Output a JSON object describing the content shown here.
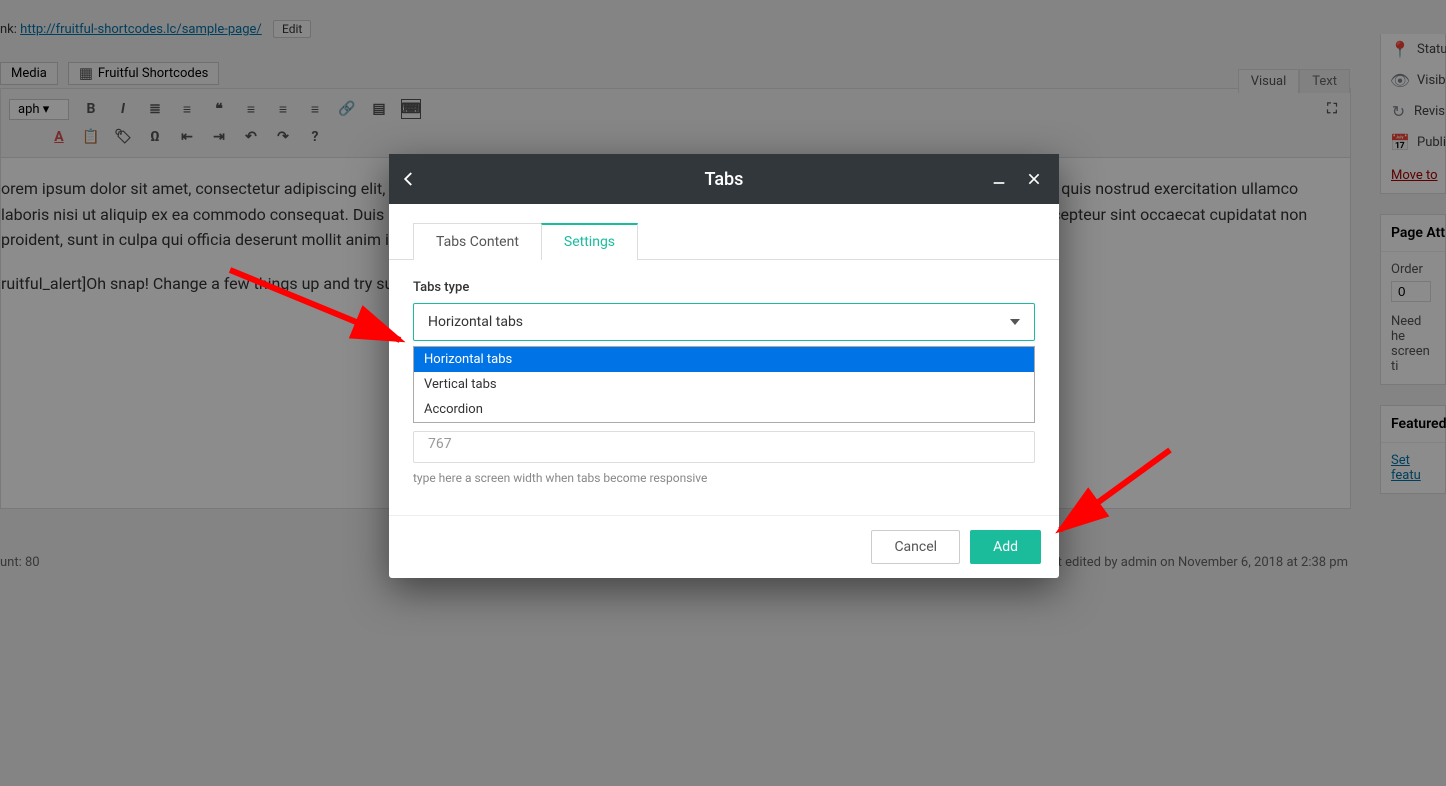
{
  "permalink": {
    "prefix": "nk: ",
    "url": "http://fruitful-shortcodes.lc/sample-page/",
    "edit": "Edit"
  },
  "media_row": {
    "media": "Media",
    "shortcodes": "Fruitful Shortcodes"
  },
  "editor_tabs": {
    "visual": "Visual",
    "text": "Text"
  },
  "toolbar_select": "aph",
  "content": {
    "p1": "orem ipsum dolor sit amet, consectetur adipiscing elit, sed do eiusmod tempor incididunt ut labore et dolore magna aliqua. Ut enim ad minim veniam, quis nostrud exercitation ullamco laboris nisi ut aliquip ex ea commodo consequat. Duis aute irure dolor in reprehenderit in voluptate velit esse cillum dolore eu fugiat nulla pariatur. Excepteur sint occaecat cupidatat non proident, sunt in culpa qui officia deserunt mollit anim id est laborum.",
    "p2": "ruitful_alert]Oh snap! Change a few things up and try submitting again.[/fruitful_alert]"
  },
  "word_count": "unt: 80",
  "last_saved": ". Last edited by admin on November 6, 2018 at 2:38 pm",
  "sidebar": {
    "status": "Statu",
    "visibility": "Visib",
    "revisions": "Revis",
    "publish": "Publi",
    "move_trash": "Move to",
    "page_attr_title": "Page Att",
    "order_label": "Order",
    "order_value": "0",
    "need_help": "Need he",
    "screen_ti": "screen ti",
    "featured_title": "Featured",
    "set_featured": "Set featu"
  },
  "modal": {
    "title": "Tabs",
    "tabs": {
      "content": "Tabs Content",
      "settings": "Settings"
    },
    "tabs_type_label": "Tabs type",
    "selected": "Horizontal tabs",
    "options": [
      "Horizontal tabs",
      "Vertical tabs",
      "Accordion"
    ],
    "input_value": "767",
    "help": "type here a screen width when tabs become responsive",
    "cancel": "Cancel",
    "add": "Add"
  }
}
